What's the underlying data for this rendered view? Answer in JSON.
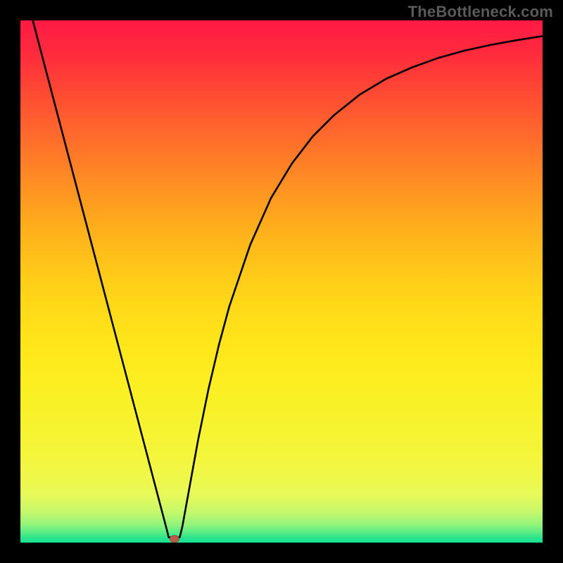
{
  "watermark": "TheBottleneck.com",
  "chart_data": {
    "type": "line",
    "title": "",
    "xlabel": "",
    "ylabel": "",
    "xlim": [
      0,
      1
    ],
    "ylim": [
      0,
      1
    ],
    "series": [
      {
        "name": "bottleneck-curve",
        "x": [
          0.0,
          0.05,
          0.1,
          0.15,
          0.2,
          0.22,
          0.24,
          0.26,
          0.28,
          0.284,
          0.305,
          0.31,
          0.32,
          0.34,
          0.36,
          0.38,
          0.4,
          0.44,
          0.48,
          0.52,
          0.56,
          0.6,
          0.65,
          0.7,
          0.75,
          0.8,
          0.85,
          0.9,
          0.95,
          1.0
        ],
        "values": [
          1.09,
          0.9,
          0.71,
          0.52,
          0.33,
          0.254,
          0.178,
          0.102,
          0.026,
          0.01,
          0.01,
          0.03,
          0.085,
          0.195,
          0.293,
          0.378,
          0.452,
          0.57,
          0.66,
          0.726,
          0.778,
          0.818,
          0.858,
          0.888,
          0.91,
          0.928,
          0.942,
          0.953,
          0.962,
          0.97
        ]
      }
    ],
    "marker": {
      "x": 0.295,
      "y": 0.007,
      "color": "#b85a4a"
    },
    "background_gradient": {
      "top": "#ff1a44",
      "bottom": "#16e293"
    }
  }
}
